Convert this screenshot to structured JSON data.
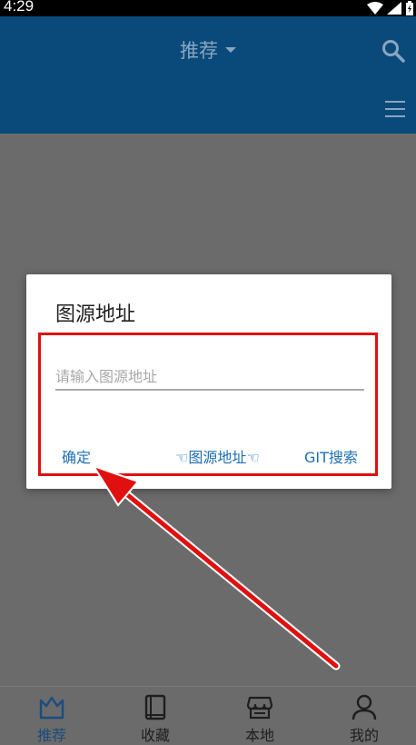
{
  "status": {
    "time": "4:29"
  },
  "appbar": {
    "title": "推荐"
  },
  "dialog": {
    "title": "图源地址",
    "input": {
      "value": "",
      "placeholder": "请输入图源地址"
    },
    "buttons": {
      "ok": "确定",
      "source": "☜图源地址☜",
      "git": "GIT搜索"
    }
  },
  "bottom_nav": {
    "items": [
      {
        "label": "推荐",
        "icon": "crown-icon"
      },
      {
        "label": "收藏",
        "icon": "book-icon"
      },
      {
        "label": "本地",
        "icon": "store-icon"
      },
      {
        "label": "我的",
        "icon": "person-icon"
      }
    ]
  },
  "colors": {
    "appbar": "#0a4a7a",
    "accent": "#1f6fb2",
    "highlight": "#e01010"
  }
}
